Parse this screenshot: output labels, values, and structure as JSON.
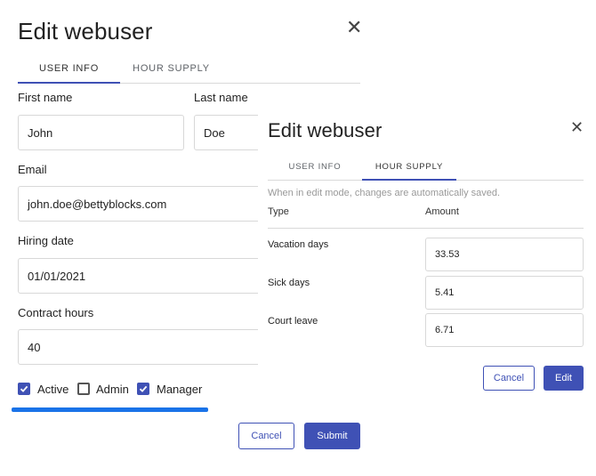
{
  "dialog1": {
    "title": "Edit webuser",
    "tabs": [
      {
        "label": "USER INFO",
        "active": true
      },
      {
        "label": "HOUR SUPPLY",
        "active": false
      }
    ],
    "fields": {
      "first_name": {
        "label": "First name",
        "value": "John"
      },
      "last_name": {
        "label": "Last name",
        "value": "Doe"
      },
      "email": {
        "label": "Email",
        "value": "john.doe@bettyblocks.com"
      },
      "hiring_date": {
        "label": "Hiring date",
        "value": "01/01/2021"
      },
      "contract_hours": {
        "label": "Contract hours",
        "value": "40"
      }
    },
    "checkboxes": [
      {
        "label": "Active",
        "checked": true
      },
      {
        "label": "Admin",
        "checked": false
      },
      {
        "label": "Manager",
        "checked": true
      }
    ],
    "cancel_label": "Cancel",
    "submit_label": "Submit"
  },
  "dialog2": {
    "title": "Edit webuser",
    "tabs": [
      {
        "label": "USER INFO",
        "active": false
      },
      {
        "label": "HOUR SUPPLY",
        "active": true
      }
    ],
    "hint": "When in edit mode, changes are automatically saved.",
    "columns": {
      "type": "Type",
      "amount": "Amount"
    },
    "rows": [
      {
        "type": "Vacation days",
        "amount": "33.53"
      },
      {
        "type": "Sick days",
        "amount": "5.41"
      },
      {
        "type": "Court leave",
        "amount": "6.71"
      }
    ],
    "cancel_label": "Cancel",
    "edit_label": "Edit"
  },
  "colors": {
    "accent": "#3f51b5",
    "highlight": "#1a73e8"
  },
  "icons": {
    "close": "close-icon",
    "check": "check-icon"
  }
}
